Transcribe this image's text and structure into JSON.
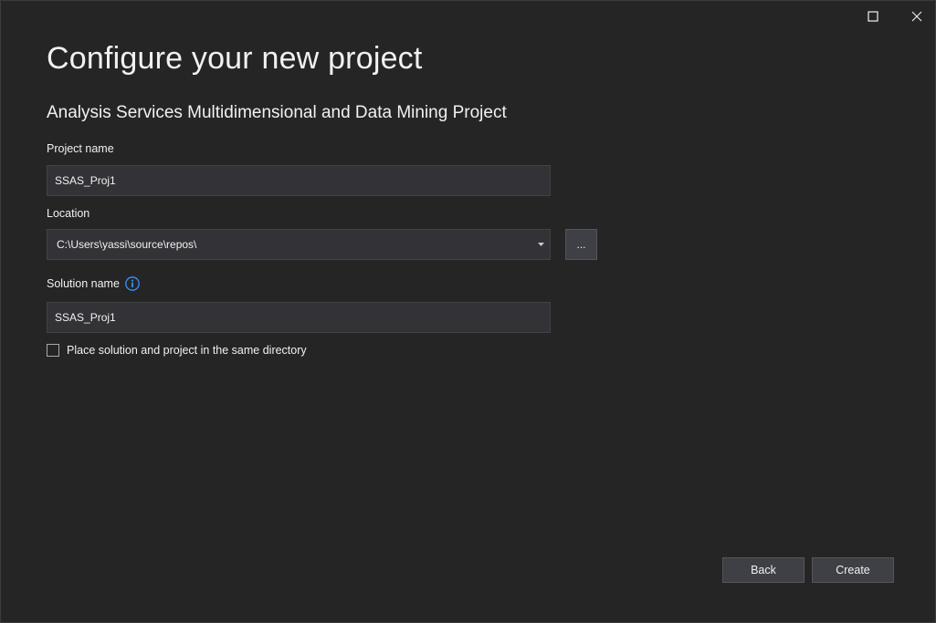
{
  "window": {
    "controls": [
      "maximize-icon",
      "close-icon"
    ]
  },
  "header": {
    "title": "Configure your new project",
    "subtitle": "Analysis Services Multidimensional and Data Mining Project"
  },
  "form": {
    "project_name": {
      "label": "Project name",
      "value": "SSAS_Proj1"
    },
    "location": {
      "label": "Location",
      "value": "C:\\Users\\yassi\\source\\repos\\",
      "browse_label": "..."
    },
    "solution_name": {
      "label": "Solution name",
      "value": "SSAS_Proj1",
      "info_icon": "info-icon"
    },
    "same_directory": {
      "label": "Place solution and project in the same directory",
      "checked": false
    }
  },
  "footer": {
    "back_label": "Back",
    "create_label": "Create"
  },
  "colors": {
    "background": "#252526",
    "input_background": "#333337",
    "button_background": "#3f3f46",
    "info_accent": "#3794ff",
    "text": "#f1f1f1"
  }
}
